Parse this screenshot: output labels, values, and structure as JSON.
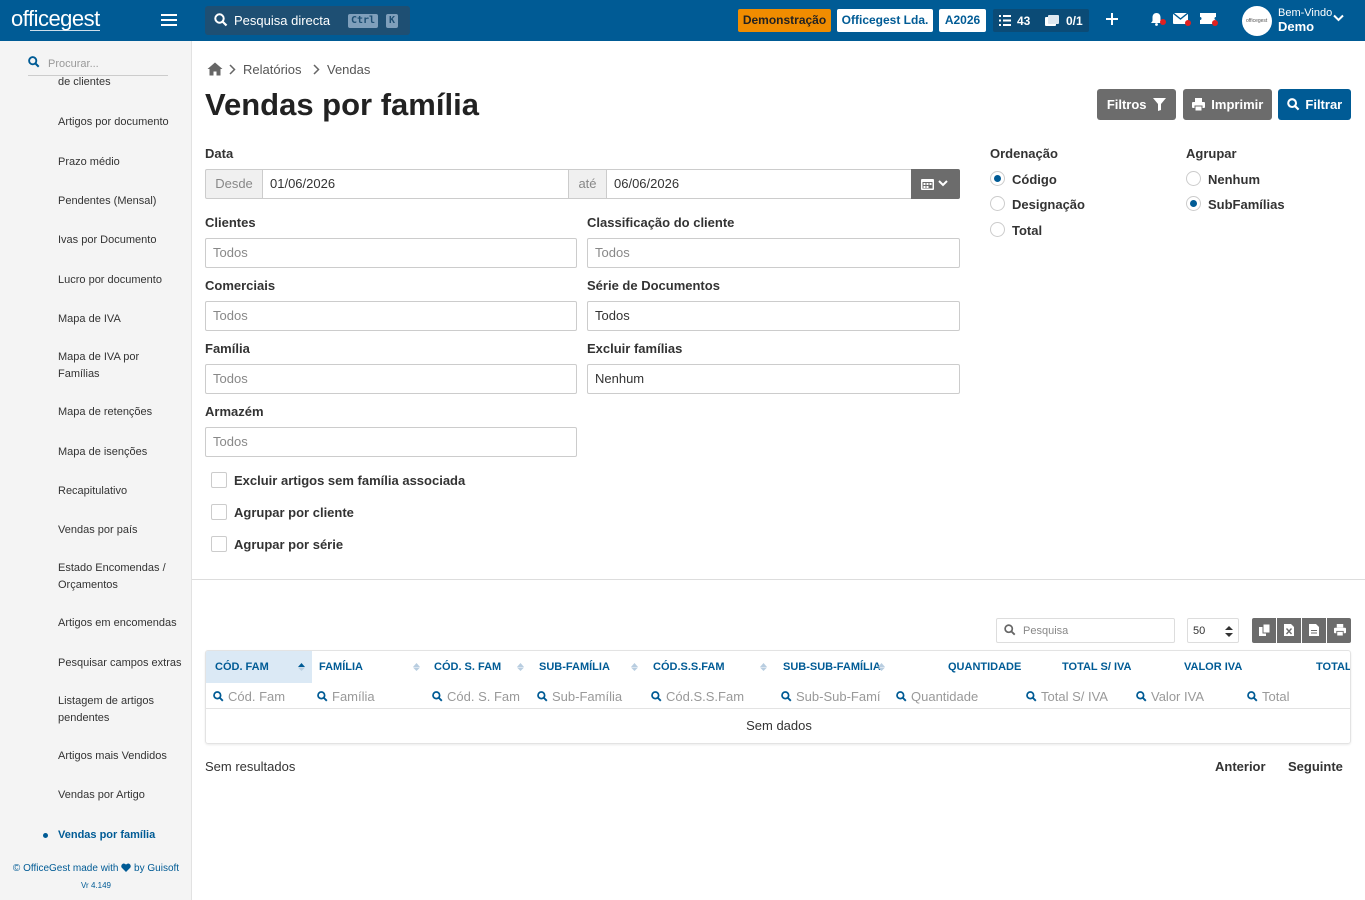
{
  "topbar": {
    "logo": "officegest",
    "search_label": "Pesquisa directa",
    "kbd_ctrl": "Ctrl",
    "kbd_k": "K",
    "badge_demo": "Demonstração",
    "badge_company": "Officegest Lda.",
    "badge_year": "A2026",
    "tasks_count": "43",
    "docs_count": "0/1",
    "welcome": "Bem-Vindo",
    "username": "Demo",
    "avatar_text": "officegest"
  },
  "sidebar": {
    "search_placeholder": "Procurar...",
    "partial_item": "de clientes",
    "items": [
      "Artigos por documento",
      "Prazo médio",
      "Pendentes (Mensal)",
      "Ivas por Documento",
      "Lucro por documento",
      "Mapa de IVA",
      "Mapa de IVA por Famílias",
      "Mapa de retenções",
      "Mapa de isenções",
      "Recapitulativo",
      "Vendas por país",
      "Estado Encomendas / Orçamentos",
      "Artigos em encomendas",
      "Pesquisar campos extras",
      "Listagem de artigos pendentes",
      "Artigos mais Vendidos",
      "Vendas por Artigo",
      "Vendas por família"
    ],
    "active_item": "Vendas por família",
    "credit_prefix": "© OfficeGest made with",
    "credit_suffix": "by Guisoft",
    "version": "Vr 4.149"
  },
  "breadcrumb": [
    "Relatórios",
    "Vendas"
  ],
  "page_title": "Vendas por família",
  "actions": {
    "filters": "Filtros",
    "print": "Imprimir",
    "filter": "Filtrar"
  },
  "form": {
    "date_label": "Data",
    "from_label": "Desde",
    "from_value": "01/06/2026",
    "to_label": "até",
    "to_value": "06/06/2026",
    "clients_label": "Clientes",
    "clients_value": "Todos",
    "client_class_label": "Classificação do cliente",
    "client_class_value": "Todos",
    "sales_label": "Comerciais",
    "sales_value": "Todos",
    "series_label": "Série de Documentos",
    "series_value": "Todos",
    "family_label": "Família",
    "family_value": "Todos",
    "exclude_families_label": "Excluir famílias",
    "exclude_families_value": "Nenhum",
    "warehouse_label": "Armazém",
    "warehouse_value": "Todos",
    "check_exclude": "Excluir artigos sem família associada",
    "check_group_client": "Agrupar por cliente",
    "check_group_series": "Agrupar por série"
  },
  "ordering": {
    "label": "Ordenação",
    "options": [
      "Código",
      "Designação",
      "Total"
    ],
    "selected": "Código"
  },
  "grouping": {
    "label": "Agrupar",
    "options": [
      "Nenhum",
      "SubFamílias"
    ],
    "selected": "SubFamílias"
  },
  "table": {
    "search_placeholder": "Pesquisa",
    "page_size": "50",
    "columns": [
      "CÓD. FAM",
      "FAMÍLIA",
      "CÓD. S. FAM",
      "SUB-FAMÍLIA",
      "CÓD.S.S.FAM",
      "SUB-SUB-FAMÍLIA",
      "QUANTIDADE",
      "TOTAL S/ IVA",
      "VALOR IVA",
      "TOTAL"
    ],
    "filters": [
      "Cód. Fam",
      "Família",
      "Cód. S. Fam",
      "Sub-Família",
      "Cód.S.S.Fam",
      "Sub-Sub-Famí",
      "Quantidade",
      "Total S/ IVA",
      "Valor IVA",
      "Total"
    ],
    "empty": "Sem dados",
    "results": "Sem resultados",
    "prev": "Anterior",
    "next": "Seguinte"
  }
}
